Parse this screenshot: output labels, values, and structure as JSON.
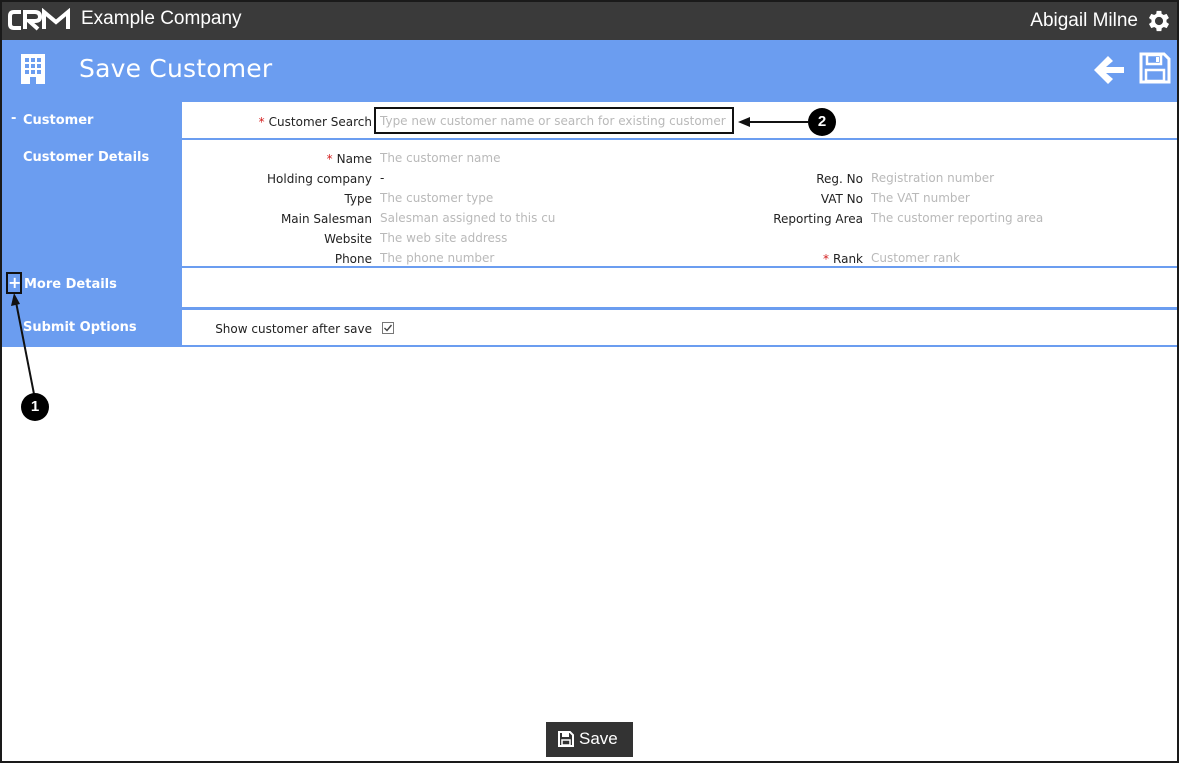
{
  "topbar": {
    "logo_icon": "crm-logo",
    "company": "Example Company",
    "user": "Abigail Milne",
    "settings_icon": "gear-icon"
  },
  "header": {
    "icon": "building-icon",
    "title": "Save Customer",
    "back_icon": "arrow-left-icon",
    "save_icon": "floppy-disk-icon"
  },
  "sections": {
    "customer": {
      "toggle": "-",
      "label": "Customer",
      "search_label": "Customer Search",
      "search_placeholder": "Type new customer name or search for existing customer"
    },
    "details": {
      "label": "Customer Details",
      "left_fields": [
        {
          "label": "Name",
          "required": true,
          "value": "The customer name"
        },
        {
          "label": "Holding company",
          "required": false,
          "value": "-"
        },
        {
          "label": "Type",
          "required": false,
          "value": "The customer type"
        },
        {
          "label": "Main Salesman",
          "required": false,
          "value": "Salesman assigned to this cu"
        },
        {
          "label": "Website",
          "required": false,
          "value": "The web site address"
        },
        {
          "label": "Phone",
          "required": false,
          "value": "The phone number"
        }
      ],
      "right_fields": [
        {
          "label": "Reg. No",
          "required": false,
          "value": "Registration number"
        },
        {
          "label": "VAT No",
          "required": false,
          "value": "The VAT number"
        },
        {
          "label": "Reporting Area",
          "required": false,
          "value": "The customer reporting area"
        },
        {
          "label": "Rank",
          "required": true,
          "value": "Customer rank"
        }
      ],
      "required_mark": "*"
    },
    "more": {
      "toggle": "+",
      "label": "More Details"
    },
    "submit": {
      "label": "Submit Options",
      "option_label": "Show customer after save",
      "checked": true
    }
  },
  "callouts": {
    "one": "1",
    "two": "2"
  },
  "footer": {
    "save_label": "Save",
    "save_icon": "floppy-disk-icon"
  },
  "colors": {
    "topbar": "#3a3a3a",
    "accent": "#6b9df0",
    "required": "#d42020",
    "placeholder": "#b9b9b9"
  }
}
